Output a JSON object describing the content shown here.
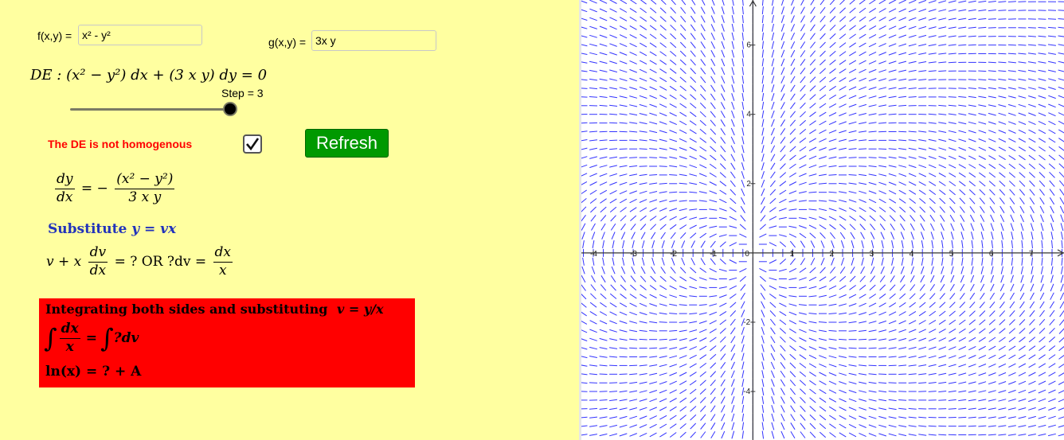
{
  "f_label": "f(x,y) =",
  "f_value": "x² - y²",
  "g_label": "g(x,y) =",
  "g_value": "3x y",
  "de": {
    "prefix": "DE :",
    "f_expr": "(x² − y²)",
    "dx": "dx +",
    "g_expr": "(3 x y)",
    "dy_eq": "dy = 0"
  },
  "slider": {
    "label": "Step = 3",
    "step": 3
  },
  "status_text": "The DE is not homogenous",
  "checkbox_checked": true,
  "refresh_label": "Refresh",
  "dydx": {
    "num": "dy",
    "den": "dx",
    "eq": "= −",
    "rhs_num": "(x² − y²)",
    "rhs_den": "3 x y"
  },
  "substitute": {
    "word": "Substitute",
    "expr": "y = vx"
  },
  "step2": {
    "lhs": "v + x",
    "num": "dv",
    "den": "dx",
    "mid": "= ? OR ?dv =",
    "rnum": "dx",
    "rden": "x"
  },
  "integrating": {
    "title": "Integrating both sides and substituting",
    "title_expr": "v = y/x",
    "int_num": "dx",
    "int_den": "x",
    "int_rhs": "?dv",
    "ln_line": "ln(x) = ? + A"
  },
  "colors": {
    "panel_bg": "#ffffa0",
    "button_green": "#009900",
    "status_red": "#ff0000",
    "box_red": "#ff0000",
    "substitute_blue": "#2233bb",
    "field_blue": "#3333ff"
  },
  "chart_data": {
    "type": "slope_field",
    "equation": "dy/dx = -(x^2 - y^2)/(3xy)",
    "x_ticks": [
      "-4",
      "-3",
      "-2",
      "-1",
      "0",
      "1",
      "2",
      "3",
      "4",
      "5",
      "6",
      "7"
    ],
    "y_ticks": [
      "6",
      "4",
      "2",
      "-2",
      "-4"
    ],
    "xlim": [
      -4.3,
      7.8
    ],
    "ylim": [
      -5.4,
      7.3
    ],
    "grid": false
  }
}
